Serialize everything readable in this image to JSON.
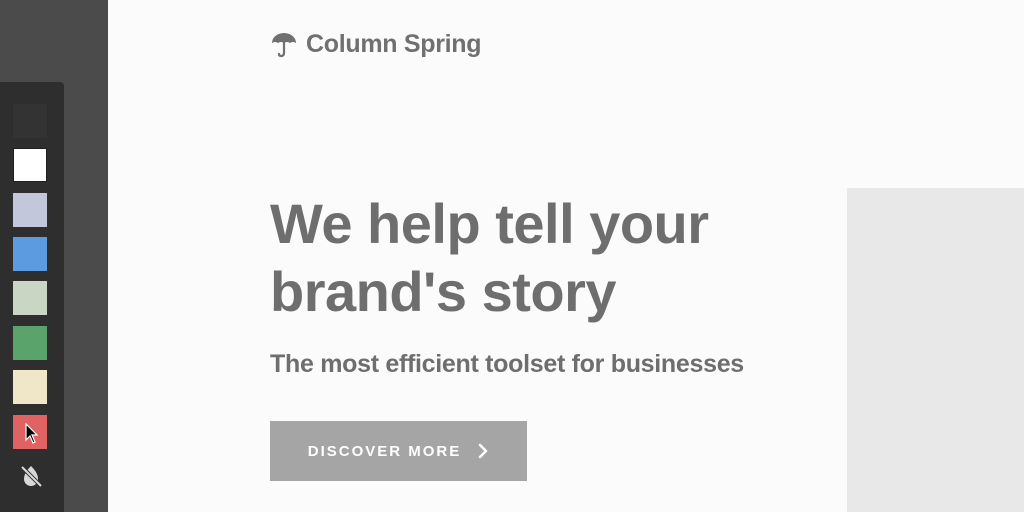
{
  "brand": {
    "name": "Column Spring",
    "icon": "umbrella-icon"
  },
  "hero": {
    "title": "We help tell your brand's story",
    "subtitle": "The most efficient toolset for businesses",
    "cta_label": "DISCOVER MORE",
    "cta_icon": "chevron-right-icon"
  },
  "palette": {
    "swatches": [
      {
        "name": "dark",
        "color": "#333333"
      },
      {
        "name": "white",
        "color": "#ffffff"
      },
      {
        "name": "lavender",
        "color": "#c3c7db"
      },
      {
        "name": "blue",
        "color": "#5d9be0"
      },
      {
        "name": "sage",
        "color": "#c8d6c3"
      },
      {
        "name": "green",
        "color": "#5aa36b"
      },
      {
        "name": "cream",
        "color": "#efe7c8"
      },
      {
        "name": "red",
        "color": "#e06262"
      }
    ],
    "reset_icon": "no-color-icon"
  },
  "colors": {
    "text": "#6e6e6e",
    "cta_bg": "#a5a5a6",
    "page_bg": "#fbfbfb",
    "palette_bg": "#2e2e2e"
  }
}
